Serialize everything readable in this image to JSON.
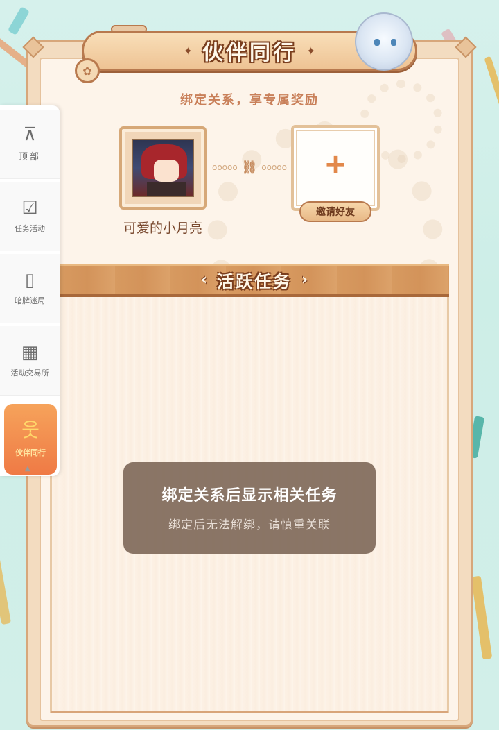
{
  "title": {
    "text": "伙伴同行",
    "decor_left": "✦",
    "decor_right": "✦"
  },
  "subtitle": "绑定关系，享专属奖励",
  "partner": {
    "name": "可爱的小月亮",
    "invite_plus": "+",
    "invite_button": "邀请好友",
    "chain_icon": "⛓"
  },
  "section": {
    "label": "活跃任务",
    "arrow_left": "‹",
    "arrow_right": "›"
  },
  "toast": {
    "title": "绑定关系后显示相关任务",
    "subtitle": "绑定后无法解绑，请慎重关联"
  },
  "sidebar": {
    "items": [
      {
        "label": "顶部",
        "icon": "top-arrow-icon",
        "glyph": "⊼"
      },
      {
        "label": "任务活动",
        "icon": "calendar-check-icon",
        "glyph": "☑"
      },
      {
        "label": "暗牌迷局",
        "icon": "cards-icon",
        "glyph": "▯"
      },
      {
        "label": "活动交易所",
        "icon": "shop-icon",
        "glyph": "▦"
      },
      {
        "label": "伙伴同行",
        "icon": "partners-icon",
        "glyph": "웃"
      }
    ],
    "caret": "▲"
  },
  "colors": {
    "accent_orange": "#ef7a45",
    "frame_brown": "#b8794e",
    "toast_bg": "#7d6758",
    "subtitle": "#c9805a"
  }
}
